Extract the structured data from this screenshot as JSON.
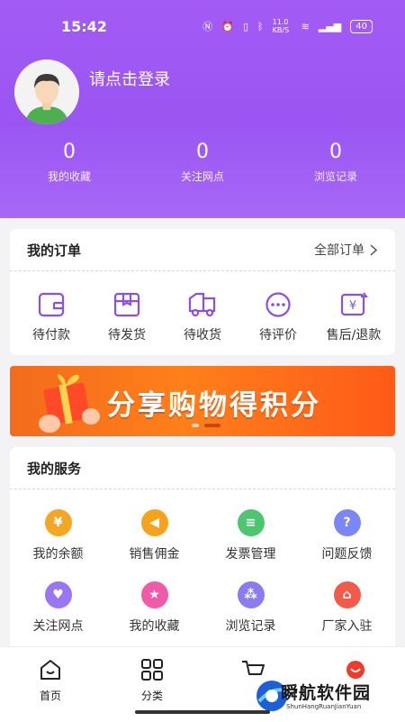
{
  "status": {
    "time": "15:42",
    "net_speed": "11.0 KB/S",
    "battery": "40"
  },
  "profile": {
    "login_text": "请点击登录"
  },
  "stats": [
    {
      "value": "0",
      "label": "我的收藏"
    },
    {
      "value": "0",
      "label": "关注网点"
    },
    {
      "value": "0",
      "label": "浏览记录"
    }
  ],
  "orders": {
    "title": "我的订单",
    "all_label": "全部订单",
    "items": [
      {
        "label": "待付款",
        "icon": "wallet-icon"
      },
      {
        "label": "待发货",
        "icon": "box-icon"
      },
      {
        "label": "待收货",
        "icon": "truck-icon"
      },
      {
        "label": "待评价",
        "icon": "comment-icon"
      },
      {
        "label": "售后/退款",
        "icon": "refund-icon"
      }
    ],
    "accent": "#8a4fe8"
  },
  "banner": {
    "text": "分享购物得积分"
  },
  "services": {
    "title": "我的服务",
    "items": [
      {
        "label": "我的余额",
        "icon": "money-bag-icon",
        "color": "#f5a623",
        "glyph": "¥"
      },
      {
        "label": "销售佣金",
        "icon": "megaphone-icon",
        "color": "#f7a21b",
        "glyph": "◀"
      },
      {
        "label": "发票管理",
        "icon": "invoice-icon",
        "color": "#4cc770",
        "glyph": "≡"
      },
      {
        "label": "问题反馈",
        "icon": "question-icon",
        "color": "#7a87f5",
        "glyph": "?"
      },
      {
        "label": "关注网点",
        "icon": "heart-icon",
        "color": "#9a75f4",
        "glyph": "♥"
      },
      {
        "label": "我的收藏",
        "icon": "star-icon",
        "color": "#f05aa8",
        "glyph": "★"
      },
      {
        "label": "浏览记录",
        "icon": "footprint-icon",
        "color": "#8a7cf0",
        "glyph": "⁂"
      },
      {
        "label": "厂家入驻",
        "icon": "shop-icon",
        "color": "#f25a4a",
        "glyph": "⌂"
      }
    ]
  },
  "tabs": [
    {
      "label": "首页",
      "icon": "home-icon"
    },
    {
      "label": "分类",
      "icon": "category-icon"
    },
    {
      "label": "",
      "icon": "cart-icon"
    },
    {
      "label": "",
      "icon": "profile-icon"
    }
  ],
  "watermark": {
    "title": "瞬航软件园",
    "subtitle": "ShunHangRuanJianYuan"
  }
}
